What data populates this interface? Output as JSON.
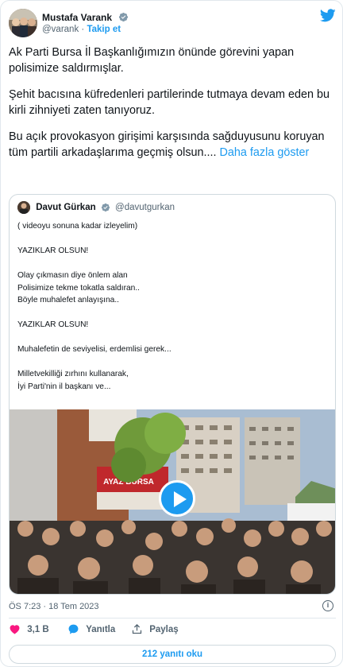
{
  "author": {
    "name": "Mustafa Varank",
    "handle": "@varank",
    "separator": "·",
    "follow_label": "Takip et"
  },
  "tweet": {
    "paragraphs": [
      "Ak Parti Bursa İl Başkanlığımızın önünde görevini yapan polisimize saldırmışlar.",
      "Şehit bacısına küfredenleri partilerinde tutmaya devam eden bu kirli zihniyeti zaten tanıyoruz.",
      "Bu açık provokasyon girişimi karşısında sağduyusunu koruyan tüm partili arkadaşlarıma geçmiş olsun...."
    ],
    "more_label": "Daha fazla göster"
  },
  "quoted": {
    "name": "Davut Gürkan",
    "handle": "@davutgurkan",
    "blocks": [
      [
        "( videoyu sonuna kadar izleyelim)"
      ],
      [
        "YAZIKLAR OLSUN!"
      ],
      [
        "Olay çıkmasın diye önlem alan",
        "Polisimize tekme tokatla saldıran..",
        "Böyle muhalefet anlayışına.."
      ],
      [
        "YAZIKLAR OLSUN!"
      ],
      [
        "Muhalefetin de seviyelisi, erdemlisi gerek..."
      ],
      [
        "Milletvekilliği zırhını kullanarak,",
        "İyi Parti'nin il başkanı ve..."
      ]
    ],
    "video_sign": "AYAZ BURSA"
  },
  "meta": {
    "timestamp": "ÖS 7:23 · 18 Tem 2023",
    "info_glyph": "i"
  },
  "actions": {
    "like_count": "3,1 B",
    "reply_label": "Yanıtla",
    "share_label": "Paylaş"
  },
  "replies_label": "212 yanıtı oku",
  "colors": {
    "accent": "#1d9bf0",
    "like": "#f91880",
    "text": "#0f1419",
    "muted": "#536471"
  }
}
